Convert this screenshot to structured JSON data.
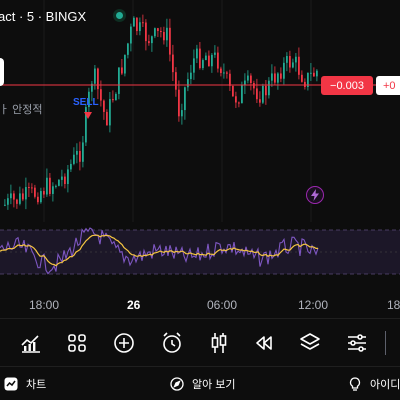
{
  "chart_data": {
    "type": "candlestick",
    "symbol_title": "act · 5 · BINGX",
    "stability_text": "ㅏ 안정적",
    "signal_label": "SELL",
    "price_tag": "−0.003",
    "price_tag_secondary": "+0",
    "time_axis": [
      "18:00",
      "26",
      "06:00",
      "12:00",
      "18"
    ],
    "candle_colors": {
      "up": "#22ab94",
      "down": "#f23645"
    },
    "oscillator": {
      "line_color": "#7e57c2",
      "signal_color": "#f5c542",
      "band_color": "#2a2140"
    }
  },
  "toolbar": {
    "icons": [
      "chart-bars-icon",
      "grid-icon",
      "plus-circle-icon",
      "alarm-clock-icon",
      "candles-icon",
      "rewind-icon",
      "layers-icon",
      "sliders-icon"
    ]
  },
  "bottom_nav": {
    "chart_label": "차트",
    "explore_label": "알아 보기",
    "ideas_label": "아이디"
  },
  "colors": {
    "background": "#0d0d0d",
    "accent_blue": "#2962ff",
    "sell_red": "#f23645",
    "buy_green": "#22ab94"
  }
}
